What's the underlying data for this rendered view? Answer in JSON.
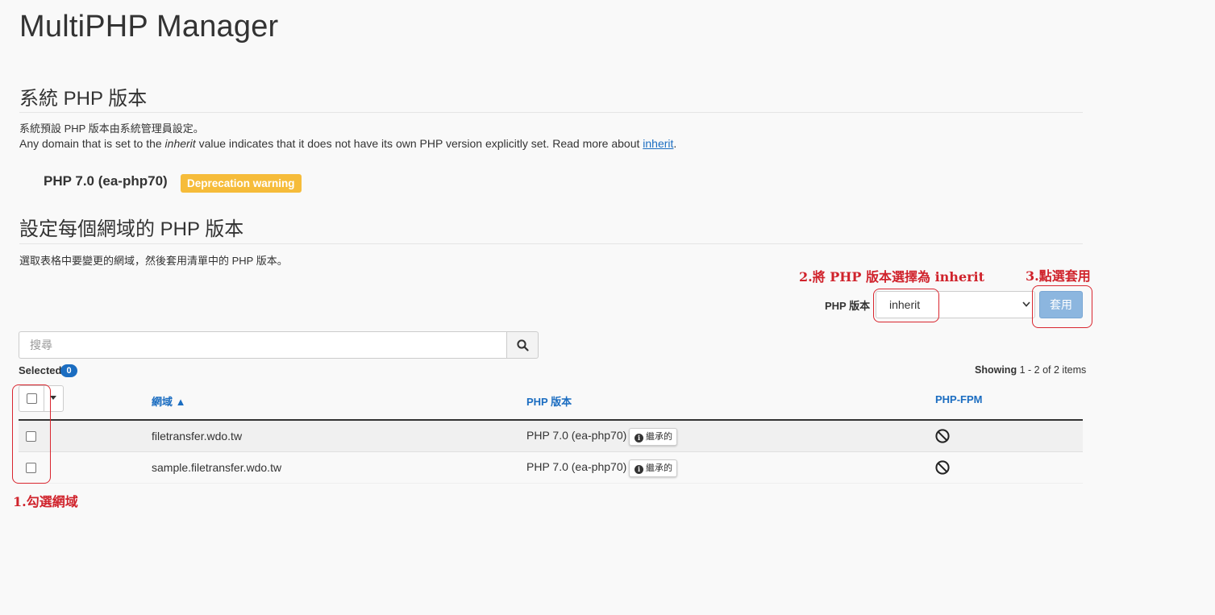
{
  "page_title": "MultiPHP Manager",
  "system_section": {
    "title": "系統 PHP 版本",
    "line1": "系統預設 PHP 版本由系統管理員設定。",
    "line2_before": "Any domain that is set to the ",
    "line2_em": "inherit",
    "line2_after": " value indicates that it does not have its own PHP version explicitly set. Read more about ",
    "line2_link": "inherit",
    "line2_end": ".",
    "current_version": "PHP 7.0 (ea-php70)",
    "warning_badge": "Deprecation warning",
    "badge_color": "#f6bc3a"
  },
  "domain_section": {
    "title": "設定每個網域的 PHP 版本",
    "instruction": "選取表格中要變更的網域，然後套用清單中的 PHP 版本。",
    "php_label": "PHP 版本",
    "php_select_value": "inherit",
    "apply_label": "套用",
    "search_placeholder": "搜尋",
    "search_icon": "search-icon",
    "selected_label": "Selected",
    "selected_count": "0",
    "showing_prefix": "Showing",
    "showing_range": "1 - 2",
    "showing_of": "of",
    "showing_total": "2",
    "showing_suffix": "items",
    "columns": {
      "domain": "網域 ▲",
      "php_version": "PHP 版本",
      "php_fpm": "PHP-FPM"
    },
    "rows": [
      {
        "domain": "filetransfer.wdo.tw",
        "php_version": "PHP 7.0 (ea-php70)",
        "inherit_badge": "繼承的",
        "fpm_icon": "disabled-icon"
      },
      {
        "domain": "sample.filetransfer.wdo.tw",
        "php_version": "PHP 7.0 (ea-php70)",
        "inherit_badge": "繼承的",
        "fpm_icon": "disabled-icon"
      }
    ],
    "accent_color": "#1b6dc1"
  },
  "annotations": {
    "step1": "1.勾選網域",
    "step2": "2.將 PHP 版本選擇為 inherit",
    "step3": "3.點選套用",
    "color": "#d0232c"
  }
}
